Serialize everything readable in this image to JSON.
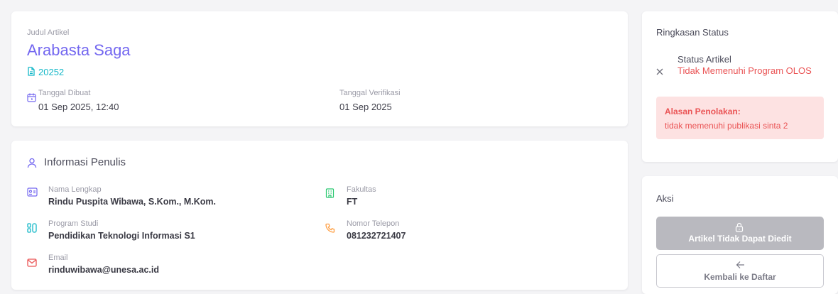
{
  "article": {
    "judul_label": "Judul Artikel",
    "title": "Arabasta Saga",
    "id": "20252",
    "tanggal_dibuat_label": "Tanggal Dibuat",
    "tanggal_dibuat": "01 Sep 2025, 12:40",
    "tanggal_verifikasi_label": "Tanggal Verifikasi",
    "tanggal_verifikasi": "01 Sep 2025"
  },
  "author": {
    "header": "Informasi Penulis",
    "nama_label": "Nama Lengkap",
    "nama": "Rindu Puspita Wibawa, S.Kom., M.Kom.",
    "fakultas_label": "Fakultas",
    "fakultas": "FT",
    "prodi_label": "Program Studi",
    "prodi": "Pendidikan Teknologi Informasi S1",
    "telepon_label": "Nomor Telepon",
    "telepon": "081232721407",
    "email_label": "Email",
    "email": "rinduwibawa@unesa.ac.id"
  },
  "status": {
    "title": "Ringkasan Status",
    "label": "Status Artikel",
    "value": "Tidak Memenuhi Program OLOS",
    "reject_label": "Alasan Penolakan:",
    "reject_reason": "tidak memenuhi publikasi sinta 2"
  },
  "actions": {
    "title": "Aksi",
    "edit_label": "Artikel Tidak Dapat Diedit",
    "back_label": "Kembali ke Daftar"
  },
  "colors": {
    "accent": "#7367f0",
    "id_cyan": "#14b8c8",
    "danger": "#ea5455",
    "danger_bg": "#fde2e2",
    "faculty_green": "#28c76f",
    "phone_orange": "#ff9f43",
    "disabled_gray": "#b9b9bf"
  }
}
